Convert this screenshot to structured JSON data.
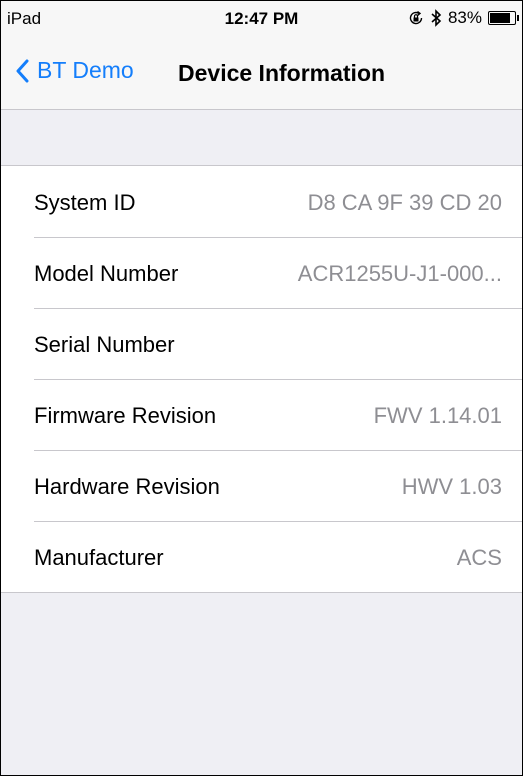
{
  "status_bar": {
    "carrier": "iPad",
    "time": "12:47 PM",
    "battery": "83%",
    "battery_level": 0.83,
    "icons": [
      "orientation-lock-icon",
      "bluetooth-icon",
      "battery-icon"
    ]
  },
  "nav": {
    "back_label": "BT Demo",
    "title": "Device Information",
    "accent_color": "#147efb"
  },
  "rows": [
    {
      "label": "System ID",
      "value": "D8 CA 9F 39 CD 20"
    },
    {
      "label": "Model Number",
      "value": "ACR1255U-J1-000..."
    },
    {
      "label": "Serial Number",
      "value": ""
    },
    {
      "label": "Firmware Revision",
      "value": "FWV 1.14.01"
    },
    {
      "label": "Hardware Revision",
      "value": "HWV 1.03"
    },
    {
      "label": "Manufacturer",
      "value": "ACS"
    }
  ]
}
